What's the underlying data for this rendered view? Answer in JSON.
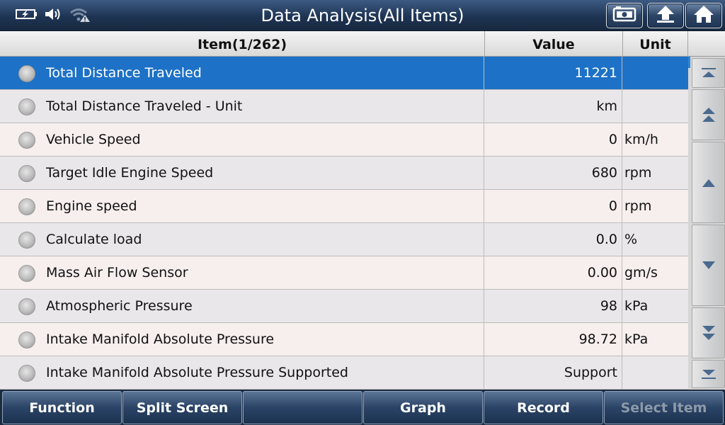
{
  "window": {
    "title": "Data Analysis(All Items)"
  },
  "status_icons": [
    "battery-charging-icon",
    "speaker-icon",
    "wifi-warning-icon"
  ],
  "title_buttons": [
    "screenshot-icon",
    "back-icon",
    "home-icon"
  ],
  "table": {
    "headers": {
      "item": "Item(1/262)",
      "value": "Value",
      "unit": "Unit"
    },
    "rows": [
      {
        "name": "Total Distance Traveled",
        "value": "11221",
        "unit": "",
        "selected": true
      },
      {
        "name": "Total Distance Traveled - Unit",
        "value": "km",
        "unit": ""
      },
      {
        "name": "Vehicle Speed",
        "value": "0",
        "unit": "km/h"
      },
      {
        "name": "Target Idle Engine Speed",
        "value": "680",
        "unit": "rpm"
      },
      {
        "name": "Engine speed",
        "value": "0",
        "unit": "rpm"
      },
      {
        "name": "Calculate load",
        "value": "0.0",
        "unit": "%"
      },
      {
        "name": "Mass Air Flow Sensor",
        "value": "0.00",
        "unit": "gm/s"
      },
      {
        "name": "Atmospheric Pressure",
        "value": "98",
        "unit": "kPa"
      },
      {
        "name": "Intake Manifold Absolute Pressure",
        "value": "98.72",
        "unit": "kPa"
      },
      {
        "name": "Intake Manifold Absolute Pressure Supported",
        "value": "Support",
        "unit": ""
      }
    ]
  },
  "scroll_buttons": [
    "scroll-top-icon",
    "page-up-icon",
    "line-up-icon",
    "line-down-icon",
    "page-down-icon",
    "scroll-bottom-icon"
  ],
  "toolbar": {
    "function": "Function",
    "split_screen": "Split Screen",
    "empty": "",
    "graph": "Graph",
    "record": "Record",
    "select_item": "Select Item"
  },
  "colors": {
    "selected_row": "#1d71c6",
    "title_bar": "#1e3454",
    "toolbar_button": "#2a4366",
    "disabled_text": "#8e9aa9"
  }
}
